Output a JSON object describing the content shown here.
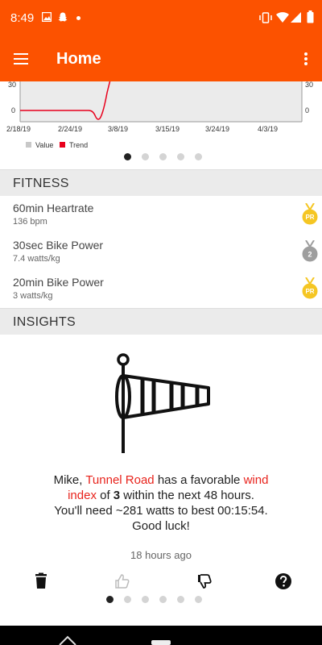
{
  "status": {
    "time": "8:49"
  },
  "header": {
    "title": "Home"
  },
  "chart_data": {
    "type": "line",
    "x": [
      "2/18/19",
      "2/24/19",
      "3/8/19",
      "3/15/19",
      "3/24/19",
      "4/3/19"
    ],
    "y_ticks_left": [
      "30",
      "0"
    ],
    "y_ticks_right": [
      "30",
      "0"
    ],
    "legend": [
      {
        "label": "Value",
        "color": "#c8c8c8"
      },
      {
        "label": "Trend",
        "color": "#e8001c"
      }
    ]
  },
  "chart_pager": {
    "count": 5,
    "active": 0
  },
  "fitness": {
    "header": "FITNESS",
    "items": [
      {
        "title": "60min Heartrate",
        "value": "136 bpm",
        "medal": "PR"
      },
      {
        "title": "30sec Bike Power",
        "value": "7.4 watts/kg",
        "medal": "2"
      },
      {
        "title": "20min Bike Power",
        "value": "3 watts/kg",
        "medal": "PR"
      }
    ]
  },
  "insights": {
    "header": "INSIGHTS",
    "text": {
      "p1": "Mike, ",
      "segment": "Tunnel Road",
      "p2": " has a favorable ",
      "wind": "wind",
      "index_word": "index",
      "p3": " of ",
      "index_value": "3",
      "p4": " within the next 48 hours.",
      "line2": "You'll need ~281 watts to best 00:15:54.",
      "line3": "Good luck!"
    },
    "time_ago": "18 hours ago",
    "pager": {
      "count": 6,
      "active": 0
    }
  },
  "colors": {
    "accent": "#fc5200",
    "gold": "#f5c623",
    "silver": "#9e9e9e",
    "highlight": "#e8231c"
  }
}
